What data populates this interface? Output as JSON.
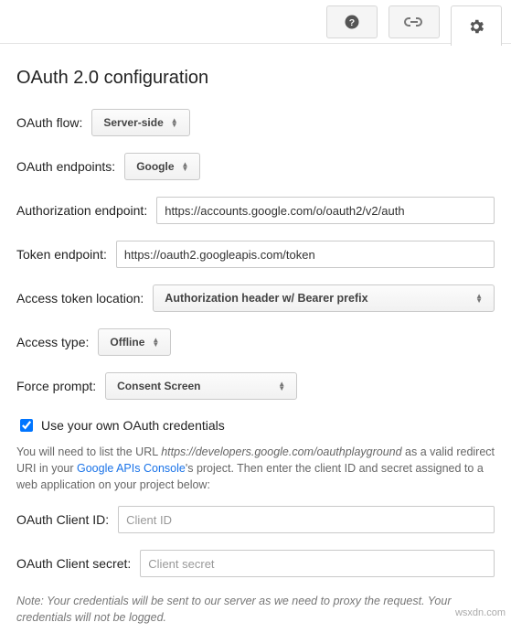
{
  "header": {
    "title": "OAuth 2.0 configuration"
  },
  "fields": {
    "oauth_flow": {
      "label": "OAuth flow:",
      "value": "Server-side"
    },
    "oauth_endpoints": {
      "label": "OAuth endpoints:",
      "value": "Google"
    },
    "auth_endpoint": {
      "label": "Authorization endpoint:",
      "value": "https://accounts.google.com/o/oauth2/v2/auth"
    },
    "token_endpoint": {
      "label": "Token endpoint:",
      "value": "https://oauth2.googleapis.com/token"
    },
    "token_location": {
      "label": "Access token location:",
      "value": "Authorization header w/ Bearer prefix"
    },
    "access_type": {
      "label": "Access type:",
      "value": "Offline"
    },
    "force_prompt": {
      "label": "Force prompt:",
      "value": "Consent Screen"
    },
    "use_own": {
      "label": "Use your own OAuth credentials",
      "checked": true
    },
    "client_id": {
      "label": "OAuth Client ID:",
      "placeholder": "Client ID",
      "value": ""
    },
    "client_secret": {
      "label": "OAuth Client secret:",
      "placeholder": "Client secret",
      "value": ""
    }
  },
  "notes": {
    "pre": "You will need to list the URL ",
    "url": "https://developers.google.com/oauthplayground",
    "mid": " as a valid redirect URI in your ",
    "link": "Google APIs Console",
    "post": "'s project. Then enter the client ID and secret assigned to a web application on your project below:",
    "footer": "Note: Your credentials will be sent to our server as we need to proxy the request. Your credentials will not be logged."
  },
  "watermark": "wsxdn.com"
}
